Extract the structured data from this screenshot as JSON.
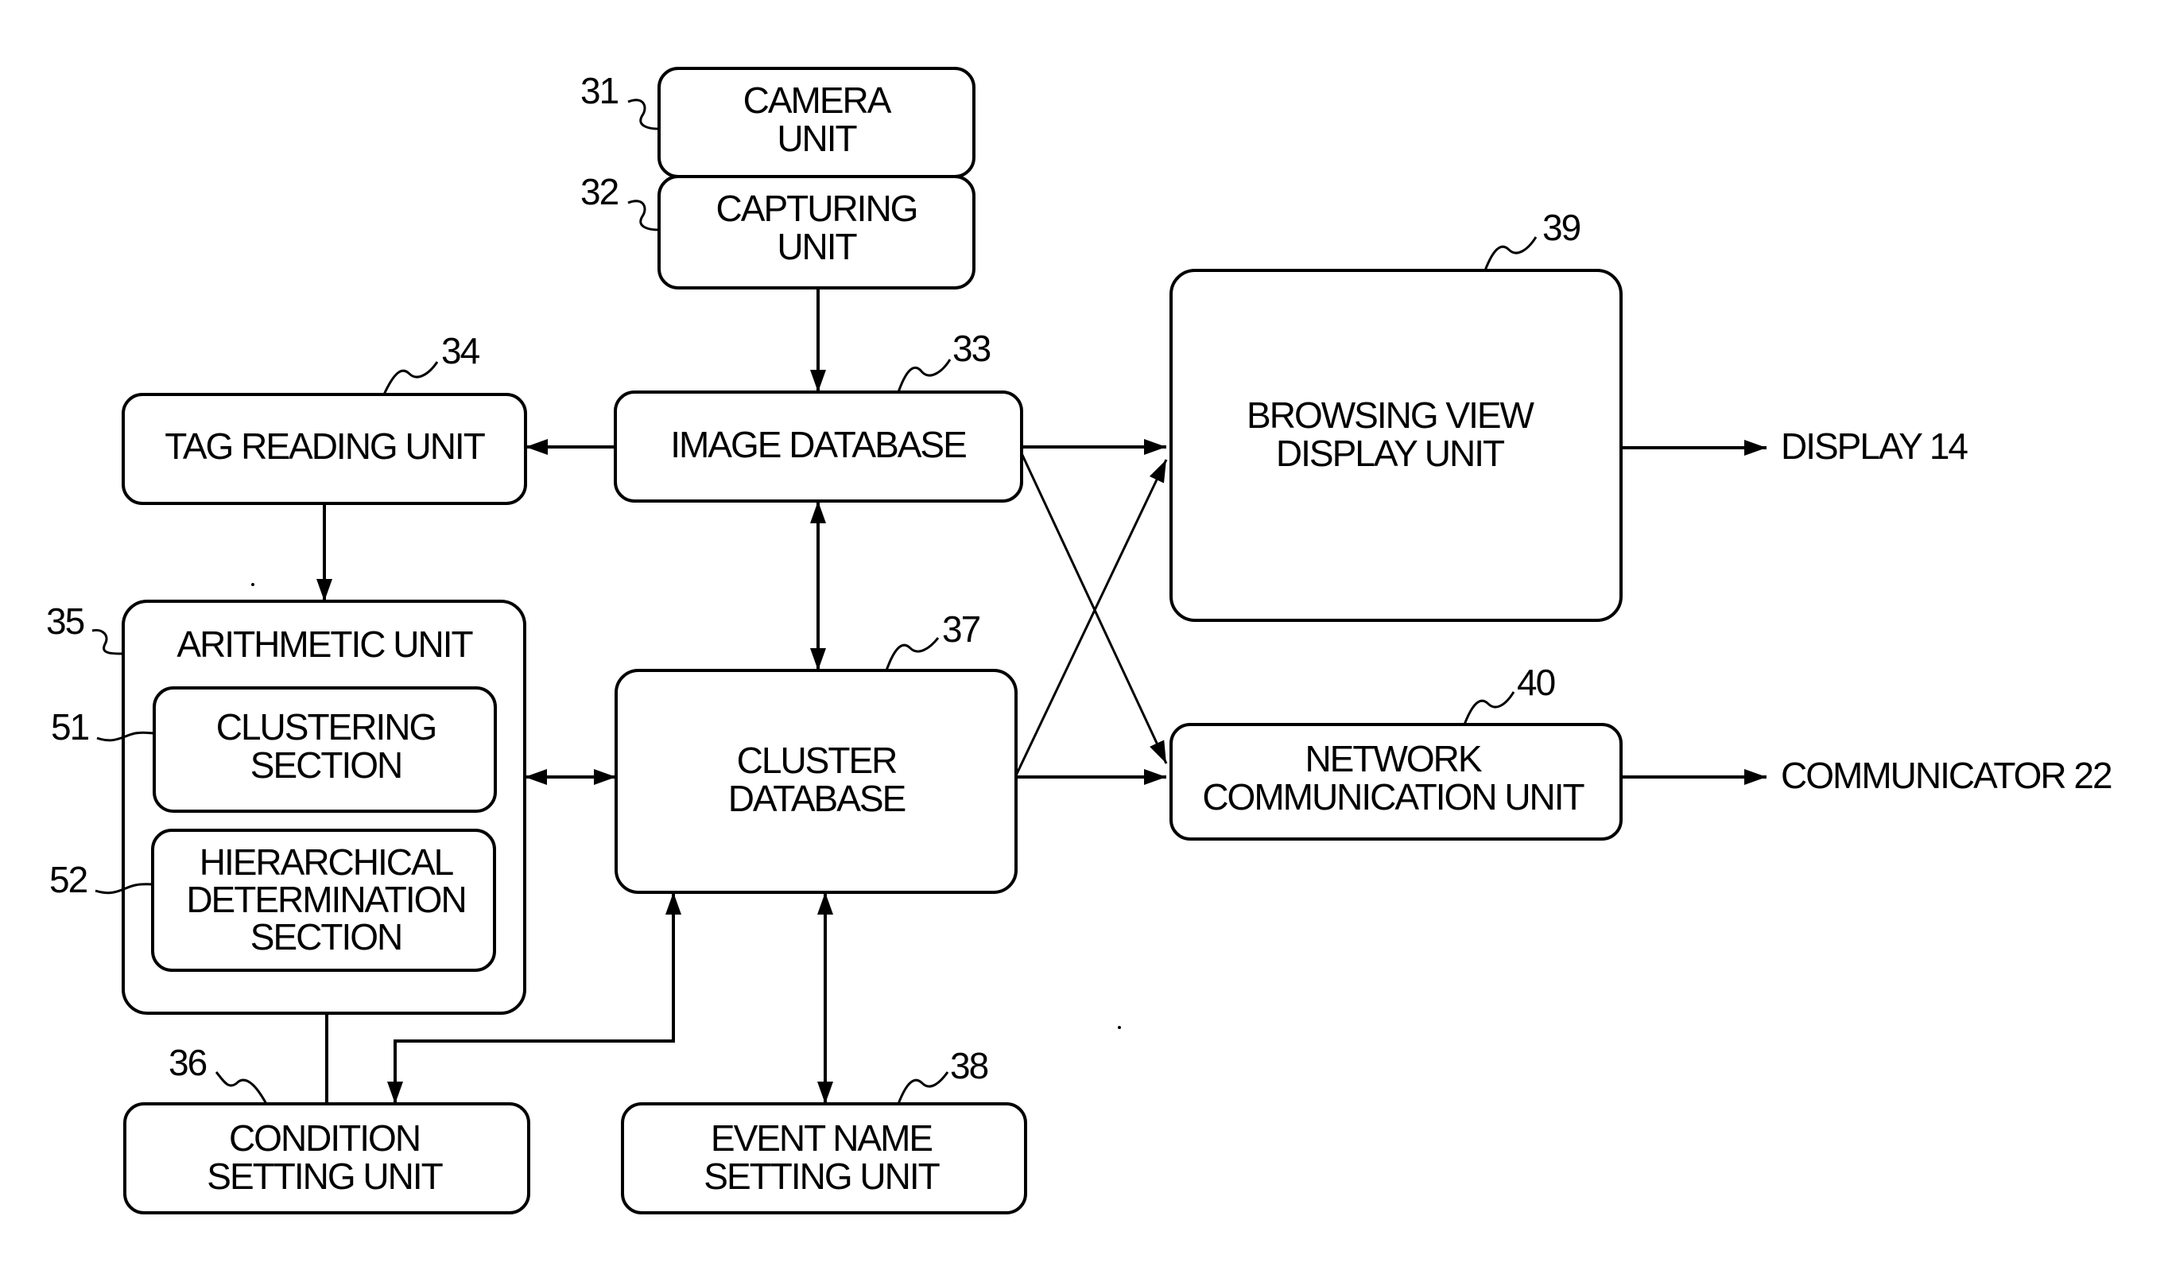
{
  "figure": {
    "type": "block-diagram",
    "blocks": {
      "camera_unit": {
        "ref": "31",
        "lines": [
          "CAMERA",
          "UNIT"
        ]
      },
      "capturing_unit": {
        "ref": "32",
        "lines": [
          "CAPTURING",
          "UNIT"
        ]
      },
      "image_database": {
        "ref": "33",
        "lines": [
          "IMAGE DATABASE"
        ]
      },
      "tag_reading_unit": {
        "ref": "34",
        "lines": [
          "TAG READING UNIT"
        ]
      },
      "arithmetic_unit": {
        "ref": "35",
        "lines": [
          "ARITHMETIC UNIT"
        ]
      },
      "clustering_section": {
        "ref": "51",
        "lines": [
          "CLUSTERING",
          "SECTION"
        ]
      },
      "hierarchical_section": {
        "ref": "52",
        "lines": [
          "HIERARCHICAL",
          "DETERMINATION",
          "SECTION"
        ]
      },
      "condition_setting_unit": {
        "ref": "36",
        "lines": [
          "CONDITION",
          "SETTING UNIT"
        ]
      },
      "cluster_database": {
        "ref": "37",
        "lines": [
          "CLUSTER",
          "DATABASE"
        ]
      },
      "event_name_setting_unit": {
        "ref": "38",
        "lines": [
          "EVENT NAME",
          "SETTING UNIT"
        ]
      },
      "browsing_view_display_unit": {
        "ref": "39",
        "lines": [
          "BROWSING VIEW",
          "DISPLAY UNIT"
        ]
      },
      "network_communication_unit": {
        "ref": "40",
        "lines": [
          "NETWORK",
          "COMMUNICATION UNIT"
        ]
      }
    },
    "outputs": {
      "display": "DISPLAY 14",
      "communicator": "COMMUNICATOR 22"
    },
    "connections": [
      {
        "from": "capturing_unit",
        "to": "image_database",
        "direction": "forward"
      },
      {
        "from": "image_database",
        "to": "tag_reading_unit",
        "direction": "forward"
      },
      {
        "from": "tag_reading_unit",
        "to": "arithmetic_unit",
        "direction": "forward"
      },
      {
        "from": "image_database",
        "to": "cluster_database",
        "direction": "bidirectional"
      },
      {
        "from": "arithmetic_unit",
        "to": "cluster_database",
        "direction": "bidirectional"
      },
      {
        "from": "image_database",
        "to": "browsing_view_display_unit",
        "direction": "forward"
      },
      {
        "from": "image_database",
        "to": "network_communication_unit",
        "direction": "forward"
      },
      {
        "from": "cluster_database",
        "to": "browsing_view_display_unit",
        "direction": "forward"
      },
      {
        "from": "cluster_database",
        "to": "network_communication_unit",
        "direction": "forward"
      },
      {
        "from": "condition_setting_unit",
        "to": "hierarchical_section",
        "direction": "forward"
      },
      {
        "from": "condition_setting_unit",
        "to": "cluster_database",
        "direction": "bidirectional"
      },
      {
        "from": "cluster_database",
        "to": "event_name_setting_unit",
        "direction": "bidirectional"
      },
      {
        "from": "browsing_view_display_unit",
        "to": "display",
        "direction": "forward"
      },
      {
        "from": "network_communication_unit",
        "to": "communicator",
        "direction": "forward"
      }
    ]
  }
}
